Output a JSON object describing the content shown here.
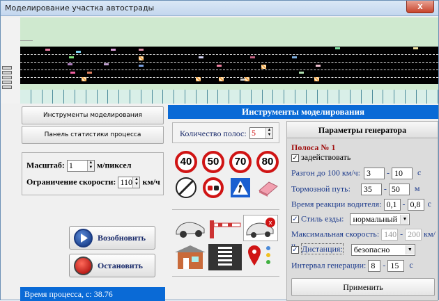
{
  "window": {
    "title": "Моделирование участка автострады",
    "close_label": "x"
  },
  "left_panel": {
    "tools_button": "Инструменты моделирования",
    "stats_button": "Панель статистики процесса",
    "scale_label": "Масштаб:",
    "scale_value": "1",
    "scale_unit": "м/пиксел",
    "speed_limit_label": "Ограничение скорости:",
    "speed_limit_value": "110",
    "speed_limit_unit": "км/ч",
    "resume_button": "Возобновить",
    "stop_button": "Остановить",
    "status_text": "Время процесса, с:  38.76"
  },
  "tools": {
    "header": "Инструменты моделирования",
    "lanes_label": "Количество полос:",
    "lanes_value": "5",
    "speed_signs": [
      "40",
      "50",
      "70",
      "80"
    ]
  },
  "generator": {
    "title": "Параметры генератора",
    "lane_title": "Полоса № 1",
    "enable_label": "задействовать",
    "accel_label": "Разгон до 100 км/ч:",
    "accel_from": "3",
    "accel_to": "10",
    "accel_unit": "с",
    "brake_label": "Тормозной путь:",
    "brake_from": "35",
    "brake_to": "50",
    "brake_unit": "м",
    "reaction_label": "Время реакции водителя:",
    "reaction_from": "0,1",
    "reaction_to": "0,8",
    "reaction_unit": "с",
    "style_label": "Стиль езды:",
    "style_value": "нормальный",
    "max_speed_label": "Максимальная скорость:",
    "max_speed_from": "140",
    "max_speed_to": "200",
    "max_speed_unit": "км/ч",
    "distance_label": "Дистанция:",
    "distance_value": "безопасно",
    "interval_label": "Интервал генерации:",
    "interval_from": "8",
    "interval_to": "15",
    "interval_unit": "с",
    "dash": "-",
    "apply_button": "Применить"
  },
  "colors": {
    "accent": "#0a6ad6",
    "sign_red": "#d01414",
    "grass": "#cfe9cf"
  }
}
